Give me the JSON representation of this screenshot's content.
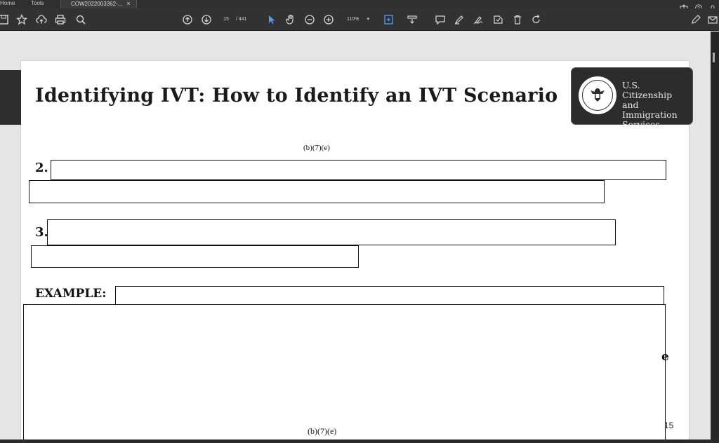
{
  "tabs": [
    {
      "label": "Home"
    },
    {
      "label": "Tools"
    },
    {
      "label": "COW2022003362-...",
      "active": true
    }
  ],
  "toolbar": {
    "page_current": "15",
    "page_total": "/ 441",
    "zoom": "110%"
  },
  "document": {
    "title": "Identifying IVT:  How to Identify an IVT Scenario",
    "redaction_label_top": "(b)(7)(e)",
    "item2_number": "2.",
    "item3_number": "3.",
    "example_label": "EXAMPLE:",
    "edge_fragment": "e",
    "redaction_label_bottom": "(b)(7)(e)",
    "page_number": "15",
    "logo": {
      "line1": "U.S. Citizenship",
      "line2": "and Immigration",
      "line3": "Services"
    }
  },
  "colors": {
    "toolbar_bg": "#323232",
    "accent_blue": "#4a9eff"
  }
}
